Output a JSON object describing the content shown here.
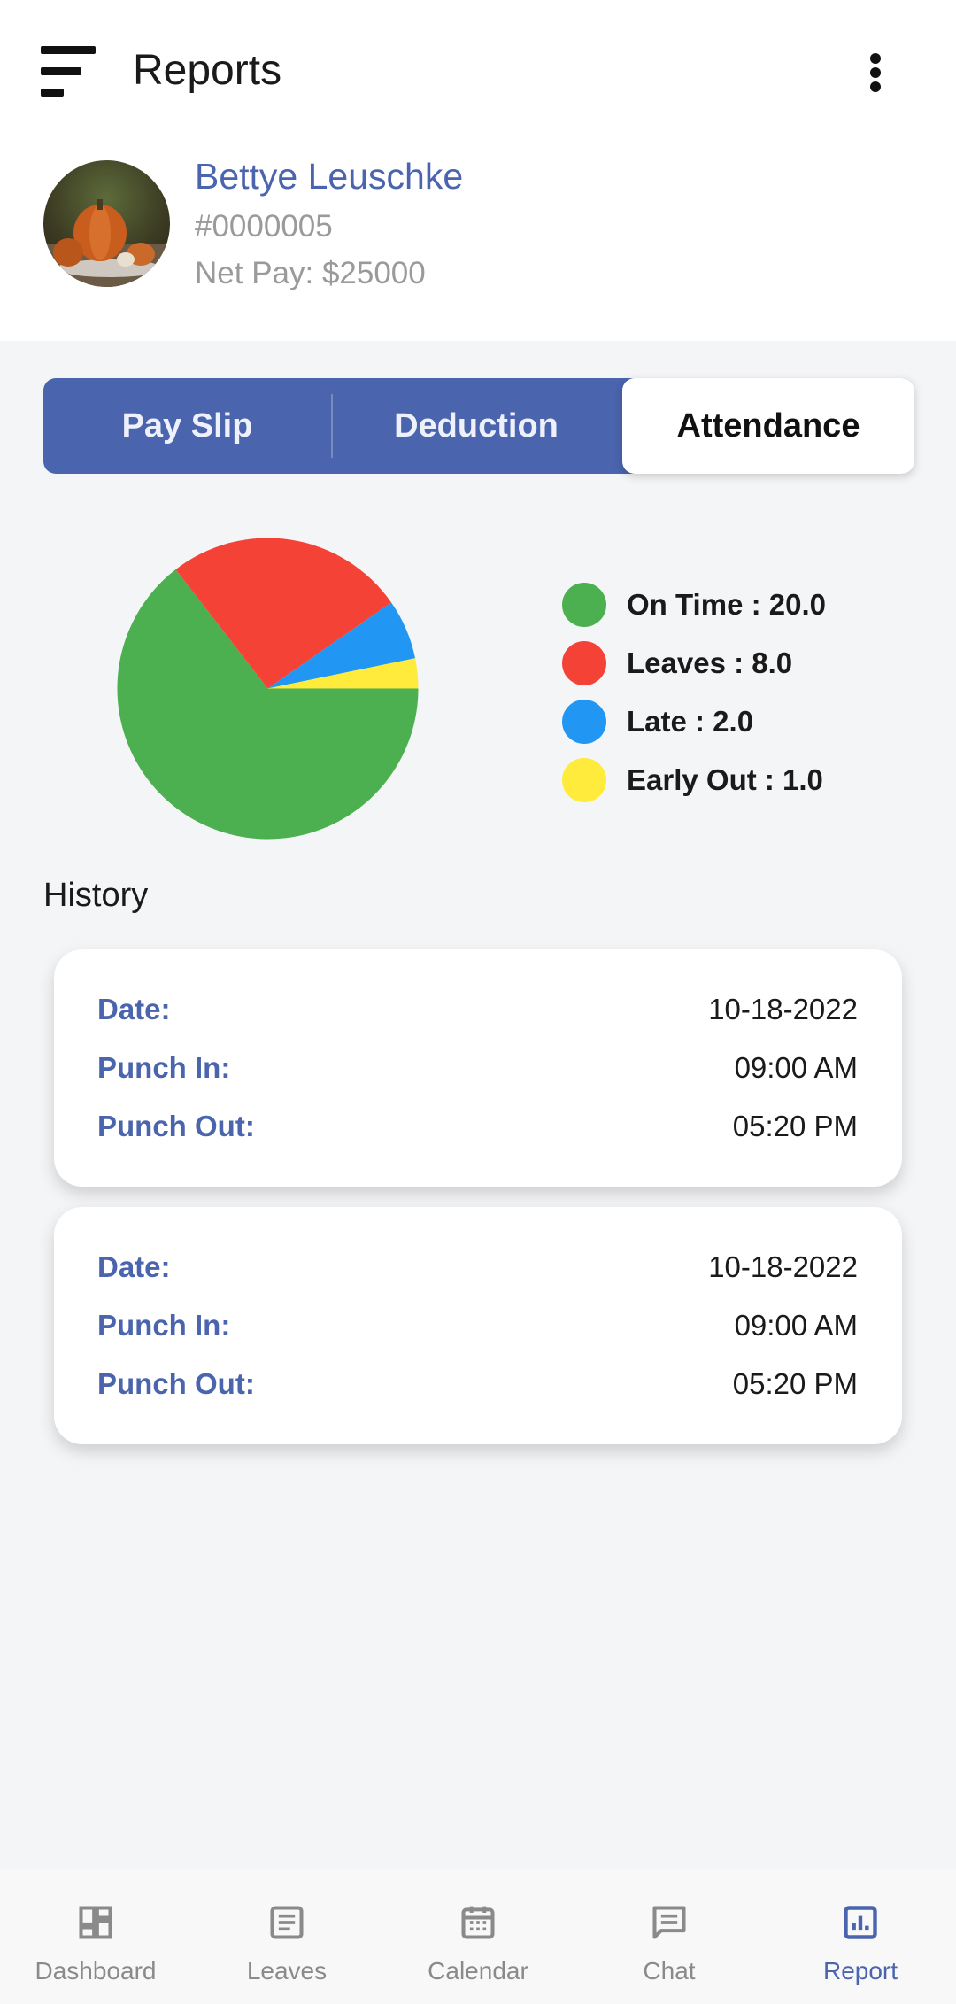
{
  "header": {
    "title": "Reports"
  },
  "employee": {
    "name": "Bettye Leuschke",
    "id": "#0000005",
    "net_pay": "Net Pay: $25000"
  },
  "tabs": [
    {
      "label": "Pay Slip",
      "active": false
    },
    {
      "label": "Deduction",
      "active": false
    },
    {
      "label": "Attendance",
      "active": true
    }
  ],
  "chart_data": {
    "type": "pie",
    "slices": [
      {
        "label": "On Time",
        "value": 20.0,
        "color": "#4caf50"
      },
      {
        "label": "Leaves",
        "value": 8.0,
        "color": "#f44336"
      },
      {
        "label": "Late",
        "value": 2.0,
        "color": "#2196f3"
      },
      {
        "label": "Early Out",
        "value": 1.0,
        "color": "#ffeb3b"
      }
    ],
    "legend_labels": [
      "On Time : 20.0",
      "Leaves : 8.0",
      "Late : 2.0",
      "Early Out : 1.0"
    ],
    "legend_placement": "right"
  },
  "history": {
    "title": "History",
    "records": [
      {
        "date_label": "Date:",
        "date": "10-18-2022",
        "in_label": "Punch In:",
        "punch_in": "09:00 AM",
        "out_label": "Punch Out:",
        "punch_out": "05:20 PM"
      },
      {
        "date_label": "Date:",
        "date": "10-18-2022",
        "in_label": "Punch In:",
        "punch_in": "09:00 AM",
        "out_label": "Punch Out:",
        "punch_out": "05:20 PM"
      }
    ]
  },
  "bottom_nav": [
    {
      "label": "Dashboard",
      "icon": "dashboard-icon"
    },
    {
      "label": "Leaves",
      "icon": "leaves-icon"
    },
    {
      "label": "Calendar",
      "icon": "calendar-icon"
    },
    {
      "label": "Chat",
      "icon": "chat-icon"
    },
    {
      "label": "Report",
      "icon": "report-icon",
      "active": true
    }
  ],
  "colors": {
    "accent": "#4a64ad",
    "muted": "#9a9a9a"
  }
}
